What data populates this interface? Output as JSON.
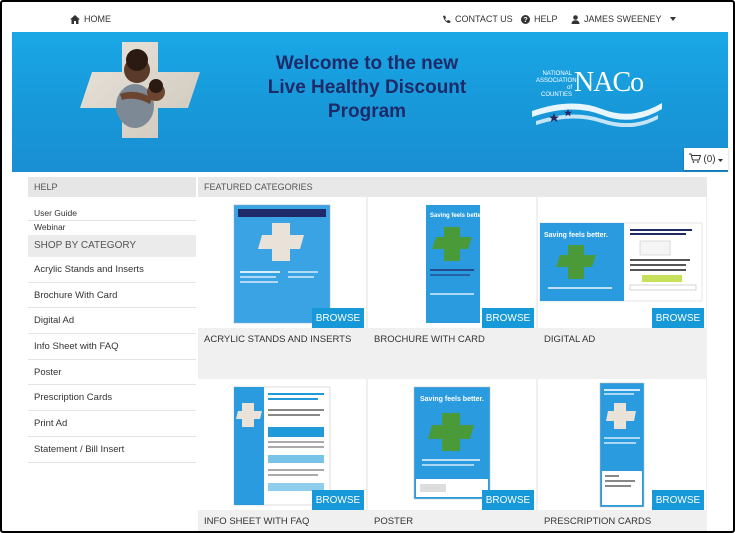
{
  "topbar": {
    "home_label": "HOME",
    "contact_label": "CONTACT US",
    "help_label": "HELP",
    "user_label": "JAMES SWEENEY"
  },
  "banner": {
    "title_line1": "Welcome to the new",
    "title_line2": "Live Healthy Discount",
    "title_line3": "Program",
    "logo_small1": "NATIONAL",
    "logo_small2": "ASSOCIATION",
    "logo_small3": "of COUNTIES",
    "logo_main": "NACo"
  },
  "cart": {
    "label": "(0)"
  },
  "sidebar": {
    "help_header": "HELP",
    "help_links": [
      "User Guide",
      "Webinar"
    ],
    "shop_header": "SHOP BY CATEGORY",
    "categories": [
      "Acrylic Stands and Inserts",
      "Brochure With Card",
      "Digital Ad",
      "Info Sheet with FAQ",
      "Poster",
      "Prescription Cards",
      "Print Ad",
      "Statement / Bill Insert"
    ]
  },
  "featured": {
    "header": "FEATURED CATEGORIES",
    "browse_label": "BROWSE",
    "tiles": [
      {
        "label": "ACRYLIC STANDS AND INSERTS"
      },
      {
        "label": "BROCHURE WITH CARD",
        "thumb_text": "Saving feels better."
      },
      {
        "label": "DIGITAL AD",
        "thumb_text": "Saving feels better."
      },
      {
        "label": "INFO SHEET WITH FAQ"
      },
      {
        "label": "POSTER",
        "thumb_text": "Saving feels better."
      },
      {
        "label": "PRESCRIPTION CARDS"
      }
    ]
  },
  "colors": {
    "accent": "#1798d9",
    "title": "#1f2a68",
    "panel": "#f0f0f0"
  }
}
